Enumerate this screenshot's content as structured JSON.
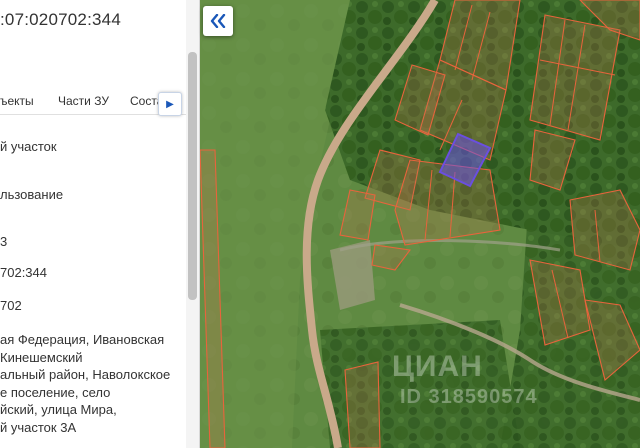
{
  "panel": {
    "cadastral_number": ":07:020702:344",
    "tabs": [
      {
        "label": "ъекты"
      },
      {
        "label": "Части ЗУ"
      },
      {
        "label": "Соста"
      }
    ],
    "fields": [
      {
        "value": "й участок"
      },
      {
        "value": "льзование"
      },
      {
        "value": "3"
      },
      {
        "value": "702:344"
      },
      {
        "value": "702"
      }
    ],
    "address_lines": [
      "ая Федерация, Ивановская",
      "Кинешемский",
      "альный район, Наволокское",
      "е поселение, село",
      "йский, улица Мира,",
      "й участок 3А"
    ]
  },
  "map": {
    "watermark": "ЦИАН",
    "watermark_id": "ID 318590574"
  },
  "icons": {
    "collapse": "double-chevron-left-icon",
    "tab_scroll": "chevron-right-icon"
  },
  "colors": {
    "accent": "#1a57b8",
    "parcel_outline": "#e8643c",
    "selected_parcel": "#6a4fe0"
  }
}
